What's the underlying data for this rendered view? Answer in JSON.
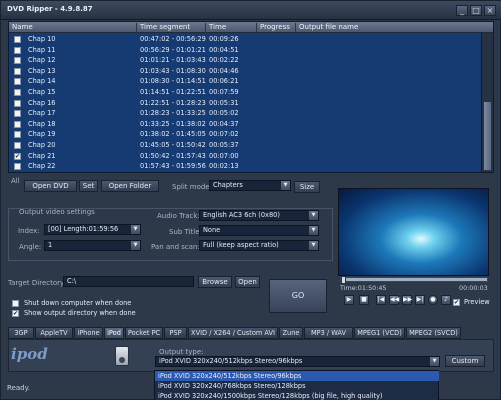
{
  "window": {
    "title": "DVD Ripper - 4.9.8.87",
    "min": "_",
    "max": "□",
    "close": "×"
  },
  "list": {
    "columns": [
      "Name",
      "Time segment",
      "Time",
      "Progress",
      "Output file name"
    ],
    "rows": [
      {
        "checked": false,
        "name": "Chap 10",
        "segment": "00:47:02 - 00:56:29",
        "time": "00:09:26"
      },
      {
        "checked": false,
        "name": "Chap 11",
        "segment": "00:56:29 - 01:01:21",
        "time": "00:04:51"
      },
      {
        "checked": false,
        "name": "Chap 12",
        "segment": "01:01:21 - 01:03:43",
        "time": "00:02:22"
      },
      {
        "checked": false,
        "name": "Chap 13",
        "segment": "01:03:43 - 01:08:30",
        "time": "00:04:46"
      },
      {
        "checked": false,
        "name": "Chap 14",
        "segment": "01:08:30 - 01:14:51",
        "time": "00:06:21"
      },
      {
        "checked": false,
        "name": "Chap 15",
        "segment": "01:14:51 - 01:22:51",
        "time": "00:07:59"
      },
      {
        "checked": false,
        "name": "Chap 16",
        "segment": "01:22:51 - 01:28:23",
        "time": "00:05:31"
      },
      {
        "checked": false,
        "name": "Chap 17",
        "segment": "01:28:23 - 01:33:25",
        "time": "00:05:02"
      },
      {
        "checked": false,
        "name": "Chap 18",
        "segment": "01:33:25 - 01:38:02",
        "time": "00:04:37"
      },
      {
        "checked": false,
        "name": "Chap 19",
        "segment": "01:38:02 - 01:45:05",
        "time": "00:07:02"
      },
      {
        "checked": false,
        "name": "Chap 20",
        "segment": "01:45:05 - 01:50:42",
        "time": "00:05:37"
      },
      {
        "checked": true,
        "name": "Chap 21",
        "segment": "01:50:42 - 01:57:43",
        "time": "00:07:00"
      },
      {
        "checked": false,
        "name": "Chap 22",
        "segment": "01:57:43 - 01:59:56",
        "time": "00:02:13"
      }
    ]
  },
  "toolbar": {
    "all_label": "All",
    "open_dvd": "Open DVD",
    "set": "Set",
    "open_folder": "Open Folder",
    "split_mode_label": "Split mode:",
    "split_mode_value": "Chapters",
    "size": "Size"
  },
  "output_video": {
    "group_label": "Output video settings",
    "index_label": "Index:",
    "index_value": "[00] Length:01:59:56",
    "angle_label": "Angle:",
    "angle_value": "1",
    "audio_track_label": "Audio Track:",
    "audio_track_value": "English AC3 6ch (0x80)",
    "subtitle_label": "Sub Title:",
    "subtitle_value": "None",
    "pan_scan_label": "Pan and scan:",
    "pan_scan_value": "Full (keep aspect ratio)"
  },
  "target": {
    "label": "Target Directory:",
    "value": "C:\\",
    "browse": "Browse",
    "open": "Open",
    "shutdown_label": "Shut down computer when done",
    "shutdown_checked": false,
    "show_output_label": "Show output directory when done",
    "show_output_checked": true,
    "go": "GO"
  },
  "player": {
    "time_label": "Time:01:50:45",
    "time_right": "00:00:03",
    "preview_label": "Preview",
    "preview_checked": true,
    "seek_fraction": 0
  },
  "tabs": [
    "3GP",
    "AppleTV",
    "iPhone",
    "iPod",
    "Pocket PC",
    "PSP",
    "XVID / X264 / Custom AVI",
    "Zune",
    "MP3 / WAV",
    "MPEG1 (VCD)",
    "MPEG2 (SVCD)"
  ],
  "active_tab": "iPod",
  "output_type": {
    "logo_text": "ipod",
    "label": "Output type:",
    "value": "iPod XVID 320x240/512kbps Stereo/96kbps",
    "custom": "Custom",
    "options": [
      "iPod XVID 320x240/512kbps Stereo/96kbps",
      "iPod XVID 320x240/768kbps Stereo/128kbps",
      "iPod XVID 320x240/1500kbps Stereo/128kbps (big file, high quality)"
    ]
  },
  "status": "Ready."
}
